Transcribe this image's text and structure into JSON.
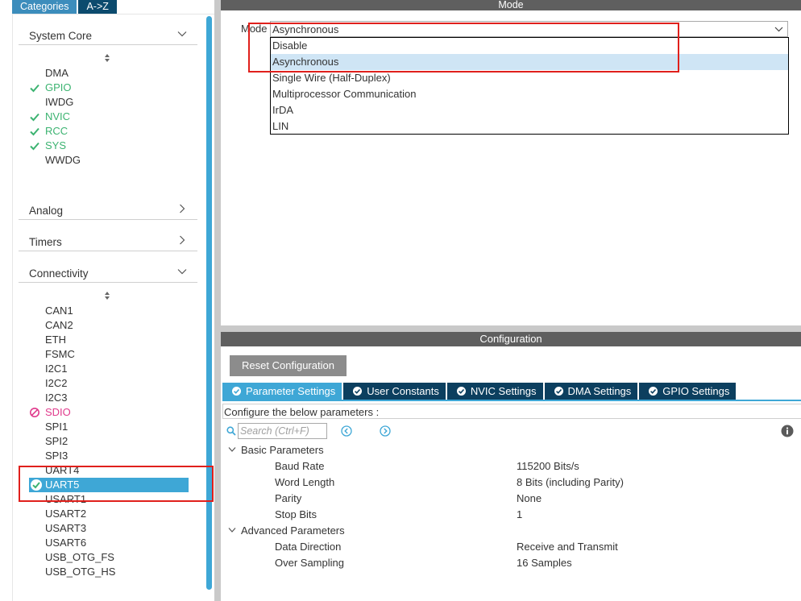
{
  "categories_tabs": {
    "active": "Categories",
    "inactive": "A->Z"
  },
  "sections": {
    "system_core": "System Core",
    "analog": "Analog",
    "timers": "Timers",
    "connectivity": "Connectivity"
  },
  "system_core_items": [
    "DMA",
    "GPIO",
    "IWDG",
    "NVIC",
    "RCC",
    "SYS",
    "WWDG"
  ],
  "connectivity_items": [
    "CAN1",
    "CAN2",
    "ETH",
    "FSMC",
    "I2C1",
    "I2C2",
    "I2C3",
    "SDIO",
    "SPI1",
    "SPI2",
    "SPI3",
    "UART4",
    "UART5",
    "USART1",
    "USART2",
    "USART3",
    "USART6",
    "USB_OTG_FS",
    "USB_OTG_HS"
  ],
  "mode_panel": {
    "title": "Mode",
    "label": "Mode",
    "selected": "Asynchronous",
    "options": [
      "Disable",
      "Asynchronous",
      "Single Wire (Half-Duplex)",
      "Multiprocessor Communication",
      "IrDA",
      "LIN"
    ]
  },
  "configuration": {
    "title": "Configuration",
    "reset_label": "Reset Configuration",
    "tabs": [
      "Parameter Settings",
      "User Constants",
      "NVIC Settings",
      "DMA Settings",
      "GPIO Settings"
    ],
    "subtitle": "Configure the below parameters :",
    "search_placeholder": "Search (Ctrl+F)",
    "groups": {
      "basic": "Basic Parameters",
      "advanced": "Advanced Parameters"
    },
    "basic_params": [
      {
        "name": "Baud Rate",
        "value": "115200 Bits/s"
      },
      {
        "name": "Word Length",
        "value": "8 Bits (including Parity)"
      },
      {
        "name": "Parity",
        "value": "None"
      },
      {
        "name": "Stop Bits",
        "value": "1"
      }
    ],
    "advanced_params": [
      {
        "name": "Data Direction",
        "value": "Receive and Transmit"
      },
      {
        "name": "Over Sampling",
        "value": "16 Samples"
      }
    ]
  },
  "colors": {
    "accent": "#3ea7d6",
    "dark_tab": "#0c3f5f",
    "ok_green": "#3cb371",
    "error_pink": "#e03a8c",
    "header_gray": "#5f5f5f",
    "highlight_red": "#e0201c"
  }
}
